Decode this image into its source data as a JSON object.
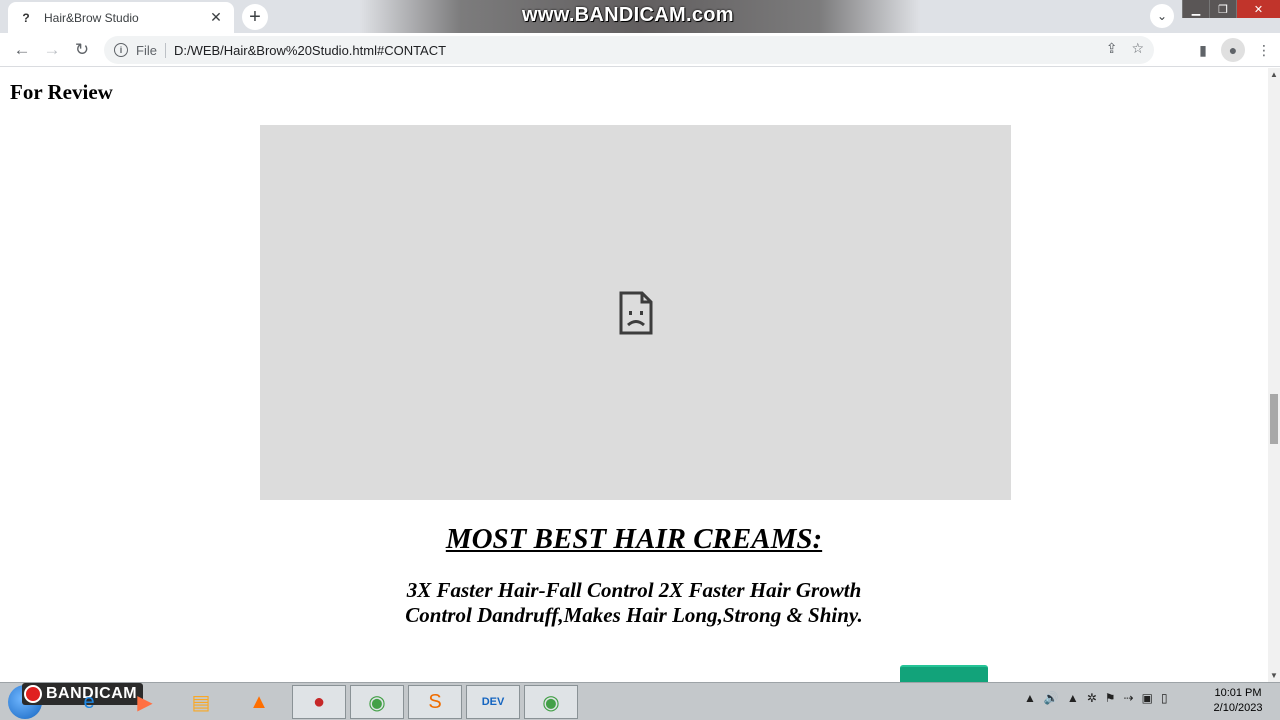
{
  "browser": {
    "tab_title": "Hair&Brow Studio",
    "tab_favicon": "?",
    "close_glyph": "✕",
    "new_tab_glyph": "+",
    "tab_search_glyph": "⌄",
    "file_label": "File",
    "url": "D:/WEB/Hair&Brow%20Studio.html#CONTACT",
    "back_glyph": "←",
    "forward_glyph": "→",
    "reload_glyph": "↻",
    "info_glyph": "i",
    "share_glyph": "⇪",
    "star_glyph": "☆",
    "sidepanel_glyph": "▮",
    "profile_glyph": "●",
    "menu_glyph": "⋮",
    "minimize_glyph": "▁",
    "maximize_glyph": "❐",
    "window_close_glyph": "✕"
  },
  "watermark": "www.BANDICAM.com",
  "page": {
    "section_heading": "For Review",
    "promo_title": "MOST BEST HAIR CREAMS:",
    "promo_line1": "3X Faster Hair-Fall Control 2X Faster Hair Growth",
    "promo_line2": "Control Dandruff,Makes Hair Long,Strong & Shiny."
  },
  "taskbar": {
    "bandicam_label": "BANDICAM",
    "apps": [
      {
        "name": "ie-icon",
        "glyph": "e"
      },
      {
        "name": "media-player-icon",
        "glyph": "▶"
      },
      {
        "name": "file-explorer-icon",
        "glyph": "▤"
      },
      {
        "name": "vlc-icon",
        "glyph": "▲"
      },
      {
        "name": "bandicam-record-icon",
        "glyph": "●"
      },
      {
        "name": "chrome-icon",
        "glyph": "◉"
      },
      {
        "name": "sublime-text-icon",
        "glyph": "S"
      },
      {
        "name": "dev-cpp-icon",
        "glyph": "DEV"
      },
      {
        "name": "chrome-active-icon",
        "glyph": "◉"
      }
    ],
    "tray_glyphs": [
      "▲",
      "🔊",
      "▲",
      "✲",
      "⚑",
      "⇢",
      "▣",
      "▯"
    ],
    "time": "10:01 PM",
    "date": "2/10/2023"
  },
  "colors": {
    "video_placeholder": "#dcdcdc",
    "product_green": "#12a37a"
  }
}
